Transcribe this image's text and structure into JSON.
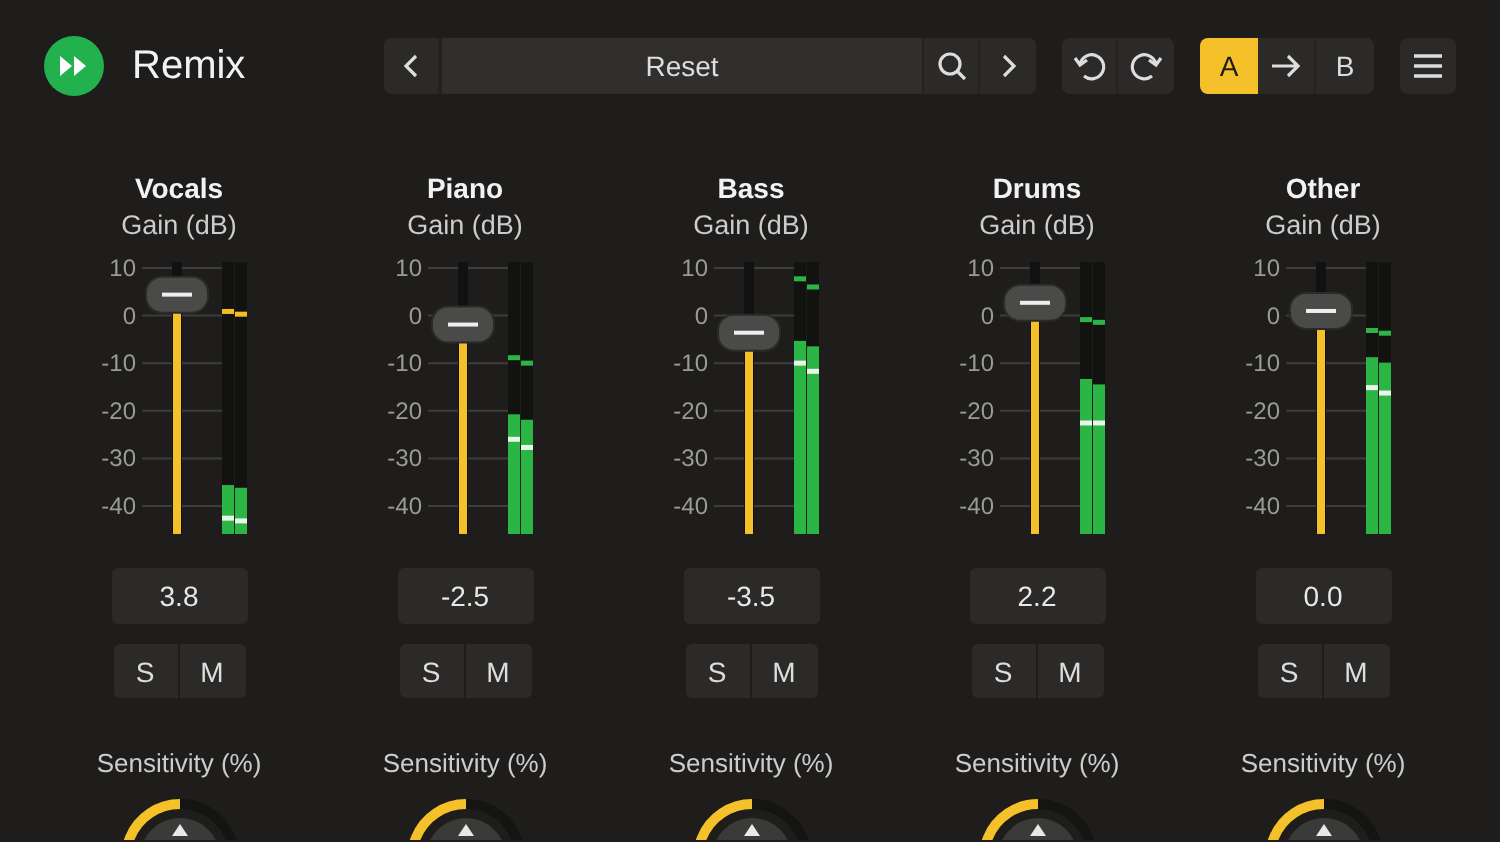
{
  "app": {
    "title": "Remix"
  },
  "preset": {
    "name": "Reset"
  },
  "ab": [
    {
      "label": "A",
      "selected": true
    },
    {
      "label": "B",
      "selected": false
    }
  ],
  "channels": [
    {
      "name": "Vocals",
      "unit": "Gain (dB)",
      "scale": [
        "10",
        "0",
        "-10",
        "-20",
        "-30",
        "-40"
      ],
      "fader": {
        "level": 0.88
      },
      "value": "3.8",
      "solo": "S",
      "mute": "M",
      "sensitivity": {
        "label": "Sensitivity (%)",
        "level": 0.5
      },
      "meters": [
        {
          "fill": {
            "level": 0.18
          },
          "rms": {
            "level": 0.06
          },
          "peak": {
            "level": 0.82,
            "color": "#f2be22"
          }
        },
        {
          "fill": {
            "level": 0.17
          },
          "rms": {
            "level": 0.05
          },
          "peak": {
            "level": 0.81,
            "color": "#f2be22"
          }
        }
      ]
    },
    {
      "name": "Piano",
      "unit": "Gain (dB)",
      "scale": [
        "10",
        "0",
        "-10",
        "-20",
        "-30",
        "-40"
      ],
      "fader": {
        "level": 0.77
      },
      "value": "-2.5",
      "solo": "S",
      "mute": "M",
      "sensitivity": {
        "label": "Sensitivity (%)",
        "level": 0.5
      },
      "meters": [
        {
          "fill": {
            "level": 0.44
          },
          "rms": {
            "level": 0.35
          },
          "peak": {
            "level": 0.65,
            "color": "#2bb545"
          }
        },
        {
          "fill": {
            "level": 0.42
          },
          "rms": {
            "level": 0.32
          },
          "peak": {
            "level": 0.63,
            "color": "#2bb545"
          }
        }
      ]
    },
    {
      "name": "Bass",
      "unit": "Gain (dB)",
      "scale": [
        "10",
        "0",
        "-10",
        "-20",
        "-30",
        "-40"
      ],
      "fader": {
        "level": 0.74
      },
      "value": "-3.5",
      "solo": "S",
      "mute": "M",
      "sensitivity": {
        "label": "Sensitivity (%)",
        "level": 0.5
      },
      "meters": [
        {
          "fill": {
            "level": 0.71
          },
          "rms": {
            "level": 0.63
          },
          "peak": {
            "level": 0.94,
            "color": "#2bb545"
          }
        },
        {
          "fill": {
            "level": 0.69
          },
          "rms": {
            "level": 0.6
          },
          "peak": {
            "level": 0.91,
            "color": "#2bb545"
          }
        }
      ]
    },
    {
      "name": "Drums",
      "unit": "Gain (dB)",
      "scale": [
        "10",
        "0",
        "-10",
        "-20",
        "-30",
        "-40"
      ],
      "fader": {
        "level": 0.85
      },
      "value": "2.2",
      "solo": "S",
      "mute": "M",
      "sensitivity": {
        "label": "Sensitivity (%)",
        "level": 0.5
      },
      "meters": [
        {
          "fill": {
            "level": 0.57
          },
          "rms": {
            "level": 0.41
          },
          "peak": {
            "level": 0.79,
            "color": "#2bb545"
          }
        },
        {
          "fill": {
            "level": 0.55
          },
          "rms": {
            "level": 0.41
          },
          "peak": {
            "level": 0.78,
            "color": "#2bb545"
          }
        }
      ]
    },
    {
      "name": "Other",
      "unit": "Gain (dB)",
      "scale": [
        "10",
        "0",
        "-10",
        "-20",
        "-30",
        "-40"
      ],
      "fader": {
        "level": 0.82
      },
      "value": "0.0",
      "solo": "S",
      "mute": "M",
      "sensitivity": {
        "label": "Sensitivity (%)",
        "level": 0.5
      },
      "meters": [
        {
          "fill": {
            "level": 0.65
          },
          "rms": {
            "level": 0.54
          },
          "peak": {
            "level": 0.75,
            "color": "#2bb545"
          }
        },
        {
          "fill": {
            "level": 0.63
          },
          "rms": {
            "level": 0.52
          },
          "peak": {
            "level": 0.74,
            "color": "#2bb545"
          }
        }
      ]
    }
  ]
}
